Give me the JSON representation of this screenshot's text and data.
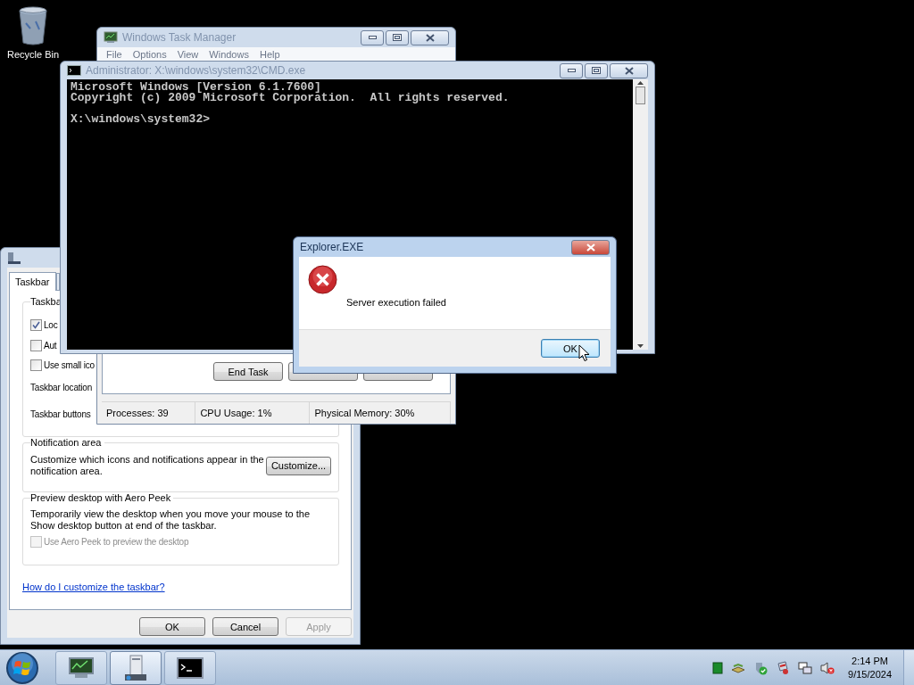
{
  "desktop_icons": [
    {
      "label": "Recycle Bin"
    }
  ],
  "taskbar_properties": {
    "tabs": [
      {
        "label": "Taskbar",
        "selected": true
      }
    ],
    "appearance_group": {
      "title": "Taskba",
      "options": [
        {
          "label": "Loc",
          "checked": true
        },
        {
          "label": "Aut",
          "checked": false
        },
        {
          "label": "Use small ico",
          "checked": false
        }
      ],
      "fields": [
        "Taskbar location",
        "Taskbar buttons"
      ]
    },
    "notification_group": {
      "title": "Notification area",
      "text": "Customize which icons and notifications appear in the notification area.",
      "button": "Customize..."
    },
    "aero_group": {
      "title": "Preview desktop with Aero Peek",
      "text": "Temporarily view the desktop when you move your mouse to the Show desktop button at end of the taskbar.",
      "option": {
        "label": "Use Aero Peek to preview the desktop",
        "checked": false,
        "disabled": true
      }
    },
    "help_link": "How do I customize the taskbar?",
    "buttons": [
      {
        "label": "OK",
        "disabled": false
      },
      {
        "label": "Cancel",
        "disabled": false
      },
      {
        "label": "Apply",
        "disabled": true
      }
    ]
  },
  "task_manager": {
    "title": "Windows Task Manager",
    "menu": [
      "File",
      "Options",
      "View",
      "Windows",
      "Help"
    ],
    "buttons": [
      "End Task"
    ],
    "status_bar": [
      "Processes: 39",
      "CPU Usage: 1%",
      "Physical Memory: 30%"
    ]
  },
  "command_prompt": {
    "title": "Administrator: X:\\windows\\system32\\CMD.exe",
    "lines": [
      "Microsoft Windows [Version 6.1.7600]",
      "Copyright (c) 2009 Microsoft Corporation.  All rights reserved."
    ],
    "prompt": "X:\\windows\\system32>"
  },
  "dialog": {
    "title": "Explorer.EXE",
    "message": "Server execution failed",
    "button": "OK"
  },
  "taskbar": {
    "apps": [
      {
        "kind": "task-manager",
        "selected": false
      },
      {
        "kind": "control-panel",
        "selected": true
      },
      {
        "kind": "console",
        "selected": false
      }
    ],
    "clock": {
      "time": "2:14 PM",
      "date": "9/15/2024"
    }
  }
}
